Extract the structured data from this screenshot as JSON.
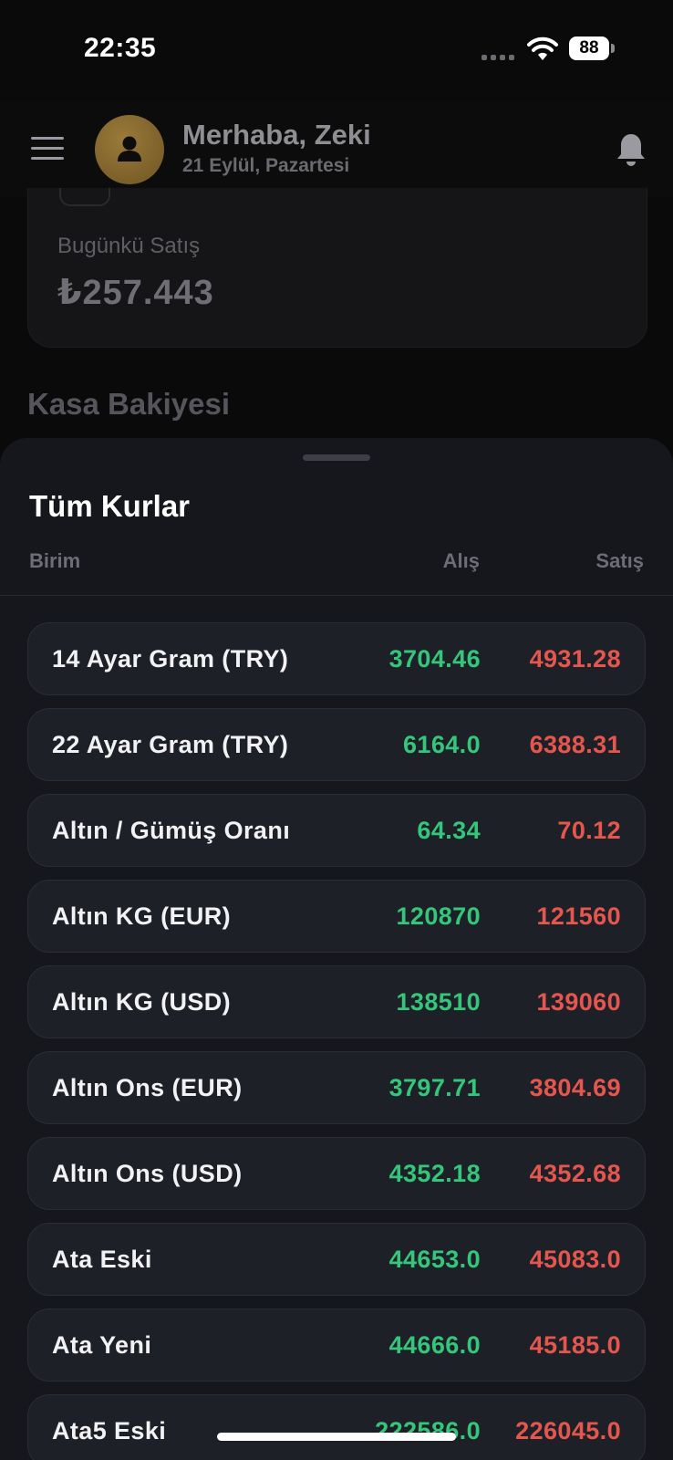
{
  "status_bar": {
    "time": "22:35",
    "battery": "88"
  },
  "header": {
    "greeting": "Merhaba, Zeki",
    "date": "21 Eylül, Pazartesi"
  },
  "background": {
    "sales_label": "Bugünkü Satış",
    "sales_value": "₺257.443",
    "cash_title": "Kasa Bakiyesi"
  },
  "sheet": {
    "title": "Tüm Kurlar",
    "columns": {
      "unit": "Birim",
      "buy": "Alış",
      "sell": "Satış"
    },
    "rates": [
      {
        "name": "14 Ayar Gram (TRY)",
        "buy": "3704.46",
        "sell": "4931.28"
      },
      {
        "name": "22 Ayar Gram (TRY)",
        "buy": "6164.0",
        "sell": "6388.31"
      },
      {
        "name": "Altın / Gümüş Oranı",
        "buy": "64.34",
        "sell": "70.12"
      },
      {
        "name": "Altın KG (EUR)",
        "buy": "120870",
        "sell": "121560"
      },
      {
        "name": "Altın KG (USD)",
        "buy": "138510",
        "sell": "139060"
      },
      {
        "name": "Altın Ons (EUR)",
        "buy": "3797.71",
        "sell": "3804.69"
      },
      {
        "name": "Altın Ons (USD)",
        "buy": "4352.18",
        "sell": "4352.68"
      },
      {
        "name": "Ata Eski",
        "buy": "44653.0",
        "sell": "45083.0"
      },
      {
        "name": "Ata Yeni",
        "buy": "44666.0",
        "sell": "45185.0"
      },
      {
        "name": "Ata5 Eski",
        "buy": "222586.0",
        "sell": "226045.0"
      }
    ]
  },
  "colors": {
    "buy": "#34c77b",
    "sell": "#e5564e",
    "sheet_bg": "#16171c",
    "row_bg": "#1e2027"
  },
  "icons": [
    "menu-icon",
    "user-icon",
    "bell-icon",
    "wifi-icon",
    "battery-icon",
    "signal-icon"
  ]
}
